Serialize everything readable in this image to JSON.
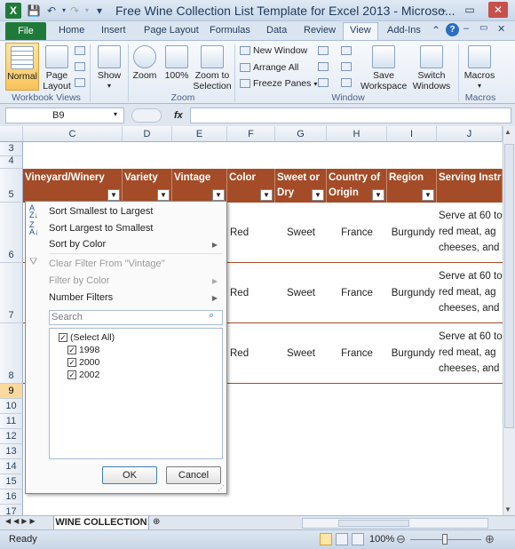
{
  "app": {
    "title": "Free Wine Collection List Template for Excel 2013 - Microso...",
    "logo": "X",
    "window_buttons": [
      "–",
      "▭",
      "✕"
    ]
  },
  "quick_access": [
    "save-icon",
    "undo-icon",
    "redo-icon",
    "customize-icon"
  ],
  "tabs": [
    "File",
    "Home",
    "Insert",
    "Page Layout",
    "Formulas",
    "Data",
    "Review",
    "View",
    "Add-Ins"
  ],
  "active_tab": "View",
  "ribbon": {
    "workbook_views": {
      "label": "Workbook Views",
      "normal": "Normal",
      "page_layout": "Page Layout"
    },
    "show": {
      "label": "Show"
    },
    "zoom": {
      "label": "Zoom",
      "zoom": "Zoom",
      "hundred": "100%",
      "zoom_selection": "Zoom to Selection"
    },
    "window": {
      "label": "Window",
      "new_window": "New Window",
      "arrange_all": "Arrange All",
      "freeze_panes": "Freeze Panes",
      "save_workspace": "Save Workspace",
      "switch_windows": "Switch Windows"
    },
    "macros": {
      "label": "Macros",
      "macros": "Macros"
    }
  },
  "formula_bar": {
    "name_box": "B9",
    "fx": "fx",
    "value": ""
  },
  "columns": [
    "C",
    "D",
    "E",
    "F",
    "G",
    "H",
    "I",
    "J"
  ],
  "rows": [
    "3",
    "4",
    "5",
    "6",
    "7",
    "8",
    "9",
    "10",
    "11",
    "12",
    "13",
    "14",
    "15",
    "16",
    "17"
  ],
  "table_headers": [
    "Vineyard/Winery",
    "Variety",
    "Vintage",
    "Color",
    "Sweet or Dry",
    "Country of Origin",
    "Region",
    "Serving Instr"
  ],
  "table_rows": [
    {
      "color": "Red",
      "sweet": "Sweet",
      "country": "France",
      "region": "Burgundy",
      "serve": [
        "Serve at 60 to",
        "red meat, ag",
        "cheeses, and"
      ]
    },
    {
      "color": "Red",
      "sweet": "Sweet",
      "country": "France",
      "region": "Burgundy",
      "serve": [
        "Serve at 60 to",
        "red meat, ag",
        "cheeses, and"
      ]
    },
    {
      "color": "Red",
      "sweet": "Sweet",
      "country": "France",
      "region": "Burgundy",
      "serve": [
        "Serve at 60 to",
        "red meat, ag",
        "cheeses, and"
      ]
    }
  ],
  "filter_menu": {
    "sort_asc": "Sort Smallest to Largest",
    "sort_desc": "Sort Largest to Smallest",
    "sort_color": "Sort by Color",
    "clear_filter": "Clear Filter From \"Vintage\"",
    "filter_color": "Filter by Color",
    "number_filters": "Number Filters",
    "search_placeholder": "Search",
    "items": [
      "(Select All)",
      "1998",
      "2000",
      "2002"
    ],
    "ok": "OK",
    "cancel": "Cancel"
  },
  "sheet": {
    "tab": "WINE COLLECTION"
  },
  "status": {
    "ready": "Ready",
    "zoom": "100%"
  },
  "colors": {
    "header_brown": "#a44b27",
    "excel_green": "#1f7a3a"
  }
}
